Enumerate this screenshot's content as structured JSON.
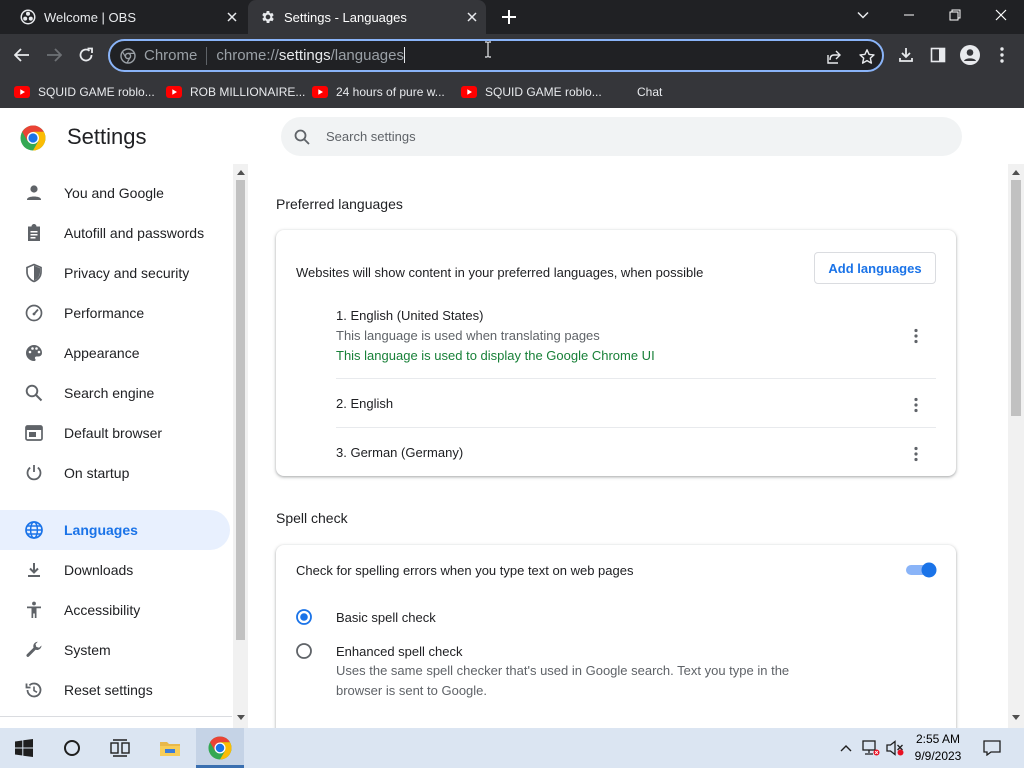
{
  "window": {
    "tabs": [
      {
        "title": "Welcome | OBS",
        "favicon": "obs-icon",
        "active": false
      },
      {
        "title": "Settings - Languages",
        "favicon": "gear-icon",
        "active": true
      }
    ]
  },
  "omnibox": {
    "scheme_label": "Chrome",
    "url_prefix": "chrome://",
    "url_highlight": "settings",
    "url_suffix": "/languages"
  },
  "bookmarks": [
    {
      "label": "SQUID GAME roblo...",
      "icon": "youtube-icon"
    },
    {
      "label": "ROB MILLIONAIRE...",
      "icon": "youtube-icon"
    },
    {
      "label": "24 hours of pure w...",
      "icon": "youtube-icon"
    },
    {
      "label": "SQUID GAME roblo...",
      "icon": "youtube-icon"
    },
    {
      "label": "Chat",
      "icon": ""
    }
  ],
  "settings": {
    "title": "Settings",
    "search_placeholder": "Search settings"
  },
  "sidebar": {
    "items": [
      {
        "label": "You and Google",
        "icon": "person-icon"
      },
      {
        "label": "Autofill and passwords",
        "icon": "clipboard-icon"
      },
      {
        "label": "Privacy and security",
        "icon": "shield-icon"
      },
      {
        "label": "Performance",
        "icon": "gauge-icon"
      },
      {
        "label": "Appearance",
        "icon": "palette-icon"
      },
      {
        "label": "Search engine",
        "icon": "search-icon"
      },
      {
        "label": "Default browser",
        "icon": "browser-icon"
      },
      {
        "label": "On startup",
        "icon": "power-icon"
      },
      {
        "label": "Languages",
        "icon": "globe-icon",
        "active": true
      },
      {
        "label": "Downloads",
        "icon": "download-icon"
      },
      {
        "label": "Accessibility",
        "icon": "accessibility-icon"
      },
      {
        "label": "System",
        "icon": "wrench-icon"
      },
      {
        "label": "Reset settings",
        "icon": "history-icon"
      }
    ]
  },
  "languages": {
    "section_title": "Preferred languages",
    "description": "Websites will show content in your preferred languages, when possible",
    "add_button": "Add languages",
    "list": [
      {
        "name": "1. English (United States)",
        "note1": "This language is used when translating pages",
        "note2": "This language is used to display the Google Chrome UI"
      },
      {
        "name": "2. English"
      },
      {
        "name": "3. German (Germany)"
      }
    ]
  },
  "spell_check": {
    "section_title": "Spell check",
    "label": "Check for spelling errors when you type text on web pages",
    "enabled": true,
    "options": [
      {
        "label": "Basic spell check",
        "selected": true,
        "description": ""
      },
      {
        "label": "Enhanced spell check",
        "selected": false,
        "description": "Uses the same spell checker that's used in Google search. Text you type in the browser is sent to Google."
      }
    ]
  },
  "colors": {
    "accent": "#1a73e8",
    "success_text": "#188038",
    "tabstrip": "#202124",
    "toolbar": "#35363a"
  },
  "taskbar": {
    "time": "2:55 AM",
    "date": "9/9/2023"
  }
}
